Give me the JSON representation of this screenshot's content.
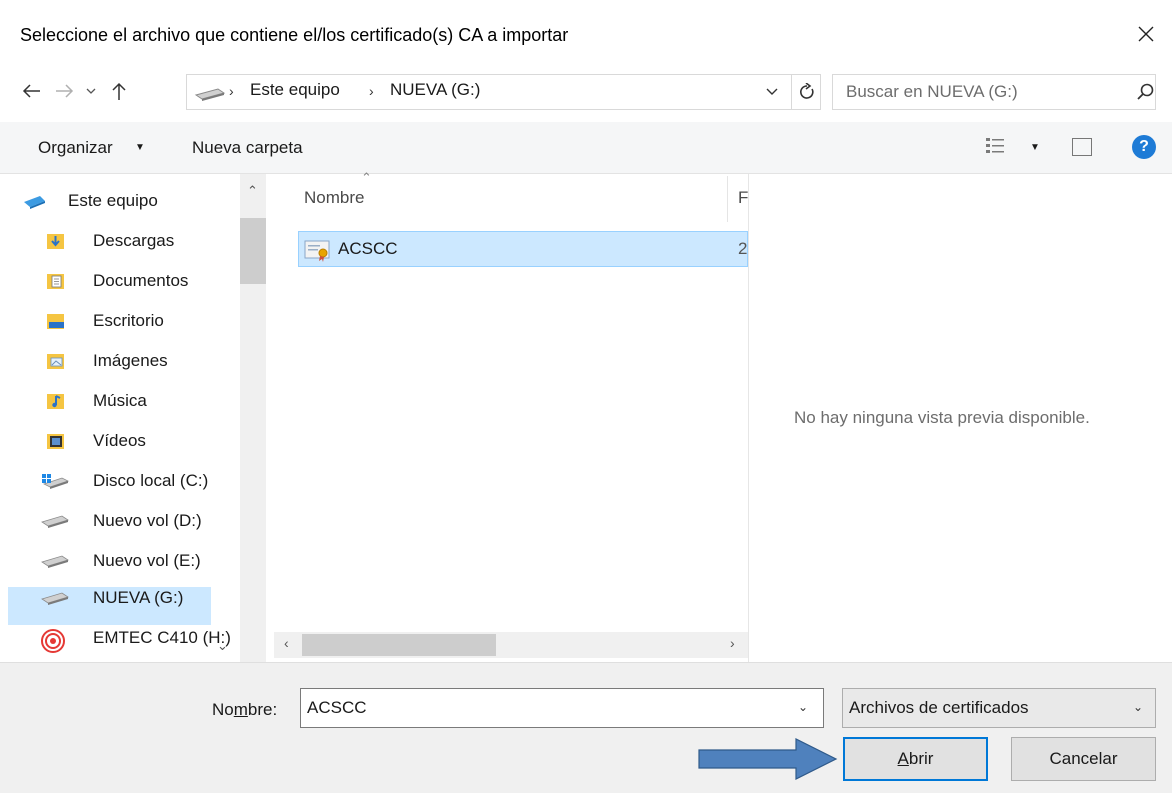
{
  "dialog": {
    "title": "Seleccione el archivo que contiene el/los certificado(s) CA a importar"
  },
  "address": {
    "crumbs": [
      "Este equipo",
      "NUEVA (G:)"
    ],
    "search_placeholder": "Buscar en NUEVA (G:)"
  },
  "toolbar": {
    "organize_label": "Organizar",
    "new_folder_label": "Nueva carpeta"
  },
  "nav": {
    "items": [
      {
        "label": "Este equipo",
        "icon": "computer-icon"
      },
      {
        "label": "Descargas",
        "icon": "downloads-folder-icon"
      },
      {
        "label": "Documentos",
        "icon": "documents-folder-icon"
      },
      {
        "label": "Escritorio",
        "icon": "desktop-folder-icon"
      },
      {
        "label": "Imágenes",
        "icon": "pictures-folder-icon"
      },
      {
        "label": "Música",
        "icon": "music-folder-icon"
      },
      {
        "label": "Vídeos",
        "icon": "videos-folder-icon"
      },
      {
        "label": "Disco local (C:)",
        "icon": "windows-drive-icon"
      },
      {
        "label": "Nuevo vol (D:)",
        "icon": "drive-icon"
      },
      {
        "label": "Nuevo vol (E:)",
        "icon": "drive-icon"
      },
      {
        "label": "NUEVA (G:)",
        "icon": "drive-icon"
      },
      {
        "label": "EMTEC C410 (H:)",
        "icon": "usb-drive-icon"
      }
    ],
    "selected": "NUEVA (G:)"
  },
  "filelist": {
    "column_name": "Nombre",
    "column_second_partial": "F",
    "files": [
      {
        "name": "ACSCC",
        "extra_partial": "2",
        "icon": "certificate-icon"
      }
    ]
  },
  "preview": {
    "message": "No hay ninguna vista previa disponible."
  },
  "footer": {
    "filename_label_pre": "No",
    "filename_label_accel": "m",
    "filename_label_post": "bre:",
    "filename_value": "ACSCC",
    "filetype_value": "Archivos de certificados",
    "open_accel": "A",
    "open_rest": "brir",
    "cancel_label": "Cancelar"
  },
  "colors": {
    "selection": "#cce8ff",
    "accent": "#0078d7",
    "arrow_fill": "#4f81bd"
  }
}
